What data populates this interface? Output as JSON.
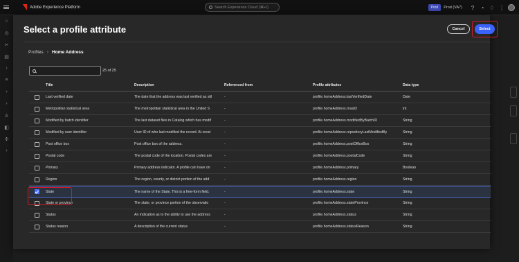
{
  "app": {
    "title": "Adobe Experience Platform",
    "search_placeholder": "Search Experience Cloud (⌘+/)",
    "env_badge": "Prod",
    "sandbox": "Prod (VA7)"
  },
  "dialog": {
    "title": "Select a profile attribute",
    "cancel_label": "Cancel",
    "select_label": "Select"
  },
  "breadcrumb": {
    "root": "Profiles",
    "separator": "›",
    "current": "Home Address"
  },
  "filter": {
    "value": "",
    "count": "25 of 25"
  },
  "table": {
    "headers": {
      "title": "Title",
      "description": "Description",
      "referenced_from": "Referenced from",
      "attribute": "Profile attributes",
      "type": "Data type"
    },
    "rows": [
      {
        "title": "Last verified date",
        "description": "The date that the address was last verified as stil",
        "ref": "-",
        "attribute": "profile.homeAddress.lastVerifiedDate",
        "type": "Date",
        "checked": false
      },
      {
        "title": "Metropolitan statistical area",
        "description": "The metropolitan statistical area in the United S",
        "ref": "-",
        "attribute": "profile.homeAddress.msaID",
        "type": "int",
        "checked": false
      },
      {
        "title": "Modified by batch identifier",
        "description": "The last dataset files in Catalog which has modif",
        "ref": "-",
        "attribute": "profile.homeAddress.modifiedByBatchID",
        "type": "String",
        "checked": false
      },
      {
        "title": "Modified by user identifier",
        "description": "User ID of who last modified the record. At creat",
        "ref": "-",
        "attribute": "profile.homeAddress.repositoryLastModifiedBy",
        "type": "String",
        "checked": false
      },
      {
        "title": "Post office box",
        "description": "Post office box of the address.",
        "ref": "-",
        "attribute": "profile.homeAddress.postOfficeBox",
        "type": "String",
        "checked": false
      },
      {
        "title": "Postal code",
        "description": "The postal code of the location. Postal codes are",
        "ref": "-",
        "attribute": "profile.homeAddress.postalCode",
        "type": "String",
        "checked": false
      },
      {
        "title": "Primary",
        "description": "Primary address indicator. A profile can have on",
        "ref": "-",
        "attribute": "profile.homeAddress.primary",
        "type": "Boolean",
        "checked": false
      },
      {
        "title": "Region",
        "description": "The region, county, or district portion of the add",
        "ref": "-",
        "attribute": "profile.homeAddress.region",
        "type": "String",
        "checked": false
      },
      {
        "title": "State",
        "description": "The name of the State. This is a free-form field.",
        "ref": "-",
        "attribute": "profile.homeAddress.state",
        "type": "String",
        "checked": true
      },
      {
        "title": "State or province",
        "description": "The state, or province portion of the observatio",
        "ref": "-",
        "attribute": "profile.homeAddress.stateProvince",
        "type": "String",
        "checked": false
      },
      {
        "title": "Status",
        "description": "An indication as to the ability to use the address",
        "ref": "-",
        "attribute": "profile.homeAddress.status",
        "type": "String",
        "checked": false
      },
      {
        "title": "Status reason",
        "description": "A description of the current status",
        "ref": "-",
        "attribute": "profile.homeAddress.statusReason",
        "type": "String",
        "checked": false
      }
    ]
  },
  "colors": {
    "accent": "#3b63fb",
    "highlight_outline": "#d21b2a",
    "selected_row": "#2c3340"
  }
}
